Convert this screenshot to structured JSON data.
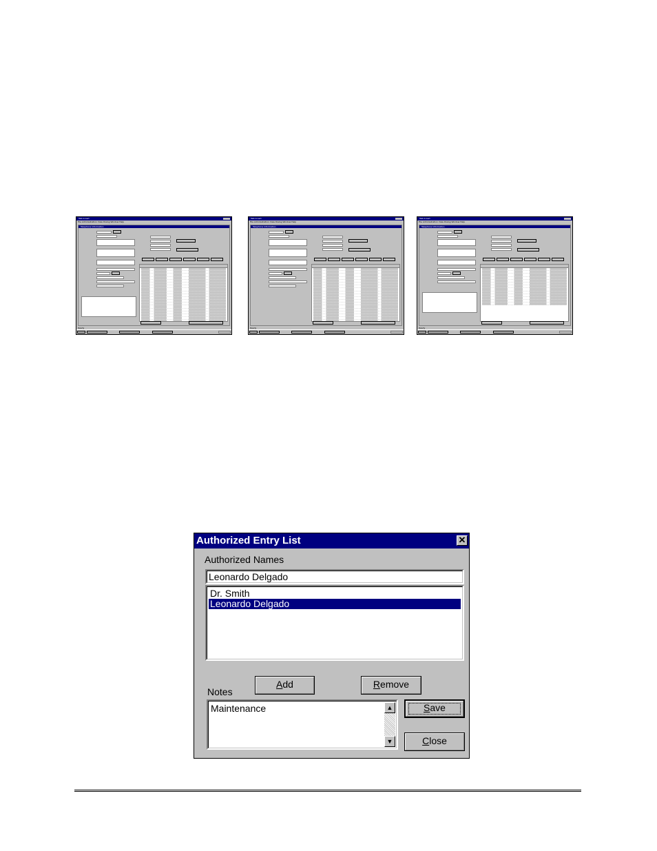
{
  "thumbnails": [
    {
      "app_title": "Talk-A-Lert",
      "menu": "File  Administration  View  Dialog  Window  Help",
      "child_title": "Telephone Information",
      "status": "Ready",
      "taskbar_start": "Start",
      "taskbar_app": "Talk-A-Lert"
    },
    {
      "app_title": "Talk-A-Lert",
      "menu": "File  Administration  View  Dialog  Window  Help",
      "child_title": "Telephone Information",
      "status": "Ready",
      "taskbar_start": "Start",
      "taskbar_app": "Talk-A-Lert"
    },
    {
      "app_title": "Talk-A-Lert",
      "menu": "File  Administration  View  Dialog  Window  Help",
      "child_title": "Telephone Information",
      "status": "Ready",
      "taskbar_start": "Start",
      "taskbar_app": "Talk-A-Lert"
    }
  ],
  "dialog": {
    "title": "Authorized Entry List",
    "close_glyph": "✕",
    "authorized_names_label": "Authorized Names",
    "name_input_value": "Leonardo Delgado",
    "names": [
      "Dr. Smith",
      "Leonardo Delgado"
    ],
    "selected_index": 1,
    "notes_label": "Notes",
    "notes_value": "Maintenance",
    "buttons": {
      "add": {
        "hotkey": "A",
        "rest": "dd"
      },
      "remove": {
        "hotkey": "R",
        "rest": "emove"
      },
      "save": {
        "hotkey": "S",
        "rest": "ave"
      },
      "close": {
        "hotkey": "C",
        "rest": "lose"
      }
    },
    "scroll_up_glyph": "▲",
    "scroll_down_glyph": "▼"
  },
  "colors": {
    "title_bar": "#000080",
    "dialog_face": "#c0c0c0",
    "selection": "#000080"
  }
}
